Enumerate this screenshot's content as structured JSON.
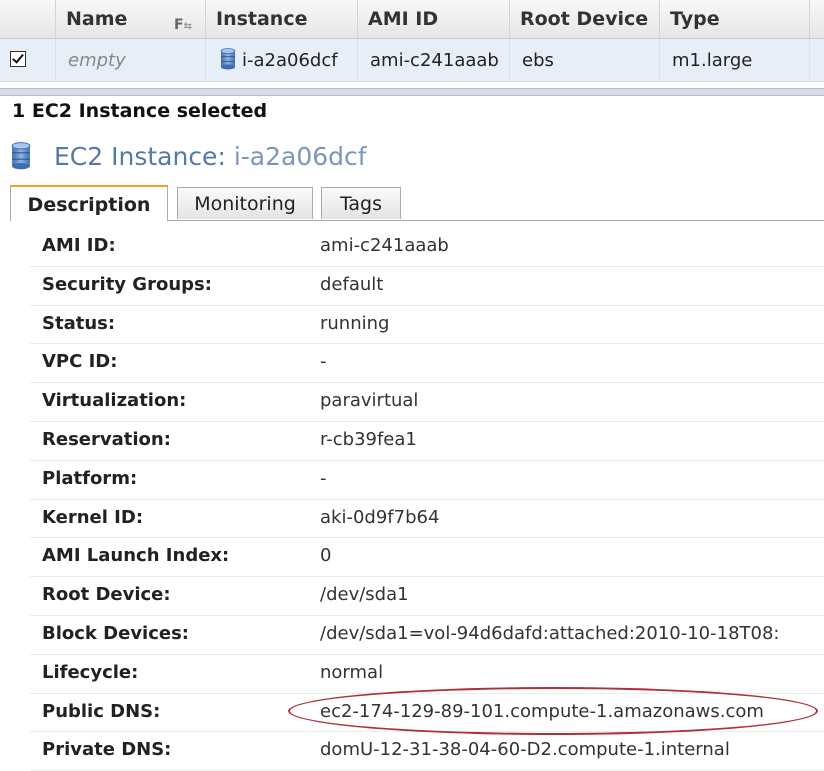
{
  "grid": {
    "columns": {
      "name": "Name",
      "instance": "Instance",
      "ami_id": "AMI ID",
      "root_device": "Root Device",
      "type": "Type"
    },
    "rows": [
      {
        "checked": true,
        "name": "empty",
        "instance": "i-a2a06dcf",
        "ami_id": "ami-c241aaab",
        "root_device": "ebs",
        "type": "m1.large"
      }
    ]
  },
  "selection": {
    "count_label": "1 EC2 Instance selected"
  },
  "detail": {
    "title_prefix": "EC2 Instance:",
    "title_value": "i-a2a06dcf",
    "tabs": [
      "Description",
      "Monitoring",
      "Tags"
    ],
    "active_tab": "Description",
    "fields": [
      {
        "label": "AMI ID:",
        "value": "ami-c241aaab"
      },
      {
        "label": "Security Groups:",
        "value": "default"
      },
      {
        "label": "Status:",
        "value": "running"
      },
      {
        "label": "VPC ID:",
        "value": "-"
      },
      {
        "label": "Virtualization:",
        "value": "paravirtual"
      },
      {
        "label": "Reservation:",
        "value": "r-cb39fea1"
      },
      {
        "label": "Platform:",
        "value": "-"
      },
      {
        "label": "Kernel ID:",
        "value": "aki-0d9f7b64"
      },
      {
        "label": "AMI Launch Index:",
        "value": "0"
      },
      {
        "label": "Root Device:",
        "value": "/dev/sda1"
      },
      {
        "label": "Block Devices:",
        "value": "/dev/sda1=vol-94d6dafd:attached:2010-10-18T08:"
      },
      {
        "label": "Lifecycle:",
        "value": "normal"
      },
      {
        "label": "Public DNS:",
        "value": "ec2-174-129-89-101.compute-1.amazonaws.com"
      },
      {
        "label": "Private DNS:",
        "value": "domU-12-31-38-04-60-D2.compute-1.internal"
      }
    ]
  },
  "icons": {
    "instance": "database-icon",
    "sort": "sort-icon",
    "checkbox": "checkbox-checked-icon",
    "highlight": "red-ellipse-annotation"
  },
  "colors": {
    "title": "#567aa6",
    "selected_row": "#e8eef8",
    "active_tab_accent": "#f0a030",
    "annotation": "#b0303a"
  }
}
